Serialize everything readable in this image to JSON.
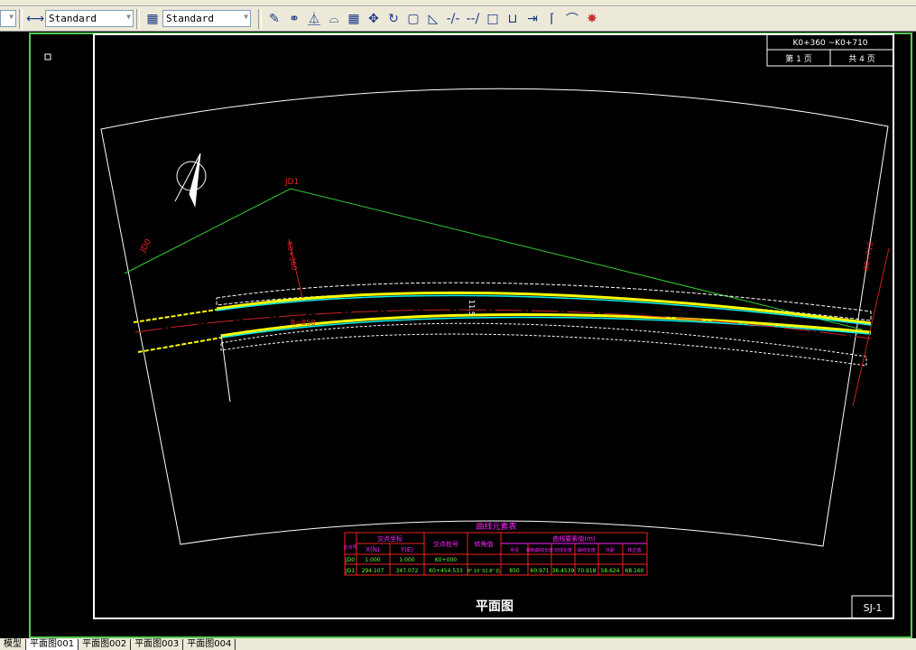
{
  "toolbar": {
    "dimstyle": "Standard",
    "tablestyle": "Standard",
    "icons": [
      "erase-icon",
      "copy-icon",
      "mirror-icon",
      "offset-icon",
      "array-icon",
      "move-icon",
      "rotate-icon",
      "scale-icon",
      "stretch-icon",
      "trim-icon",
      "extend-icon",
      "break-icon",
      "break-at-point-icon",
      "join-icon",
      "chamfer-icon",
      "fillet-icon",
      "explode-icon"
    ]
  },
  "title_block": {
    "range": "K0+360 ~K0+710",
    "page": "第 1 页",
    "total": "共 4 页",
    "drawing_title": "平面图",
    "drawing_no": "SJ-1"
  },
  "annotations": {
    "jd1": "JD1",
    "jd0": "JD0",
    "width": "11.5",
    "stake_start": "K0+360",
    "stake_end": "K0+710",
    "curve_r": "R=850"
  },
  "curve_table": {
    "title": "曲线元素表",
    "headers": {
      "jd": "交点号",
      "coord": "交点坐标",
      "x": "X(N)",
      "y": "Y(E)",
      "stake": "交点桩号",
      "angle": "转角值",
      "elements": "曲线要素值(m)",
      "cols": [
        "半径",
        "缓和曲线长度",
        "切线长度",
        "曲线长度",
        "外距",
        "校正值"
      ]
    },
    "rows": [
      {
        "jd": "JD0",
        "x": "1.000",
        "y": "1.000",
        "stake": "K0+000",
        "angle": "",
        "vals": [
          "",
          "",
          "",
          "",
          "",
          ""
        ]
      },
      {
        "jd": "JD1",
        "x": "294.107",
        "y": "347.072",
        "stake": "K0+454.533",
        "angle": "8° 10' 02.8\" 右",
        "vals": [
          "850",
          "60.971",
          "36.4539",
          "70.918",
          "58.624",
          "68.160"
        ]
      }
    ]
  },
  "tabs": [
    {
      "label": "模型",
      "active": false
    },
    {
      "label": "平面图001",
      "active": true
    },
    {
      "label": "平面图002",
      "active": false
    },
    {
      "label": "平面图003",
      "active": false
    },
    {
      "label": "平面图004",
      "active": false
    }
  ]
}
